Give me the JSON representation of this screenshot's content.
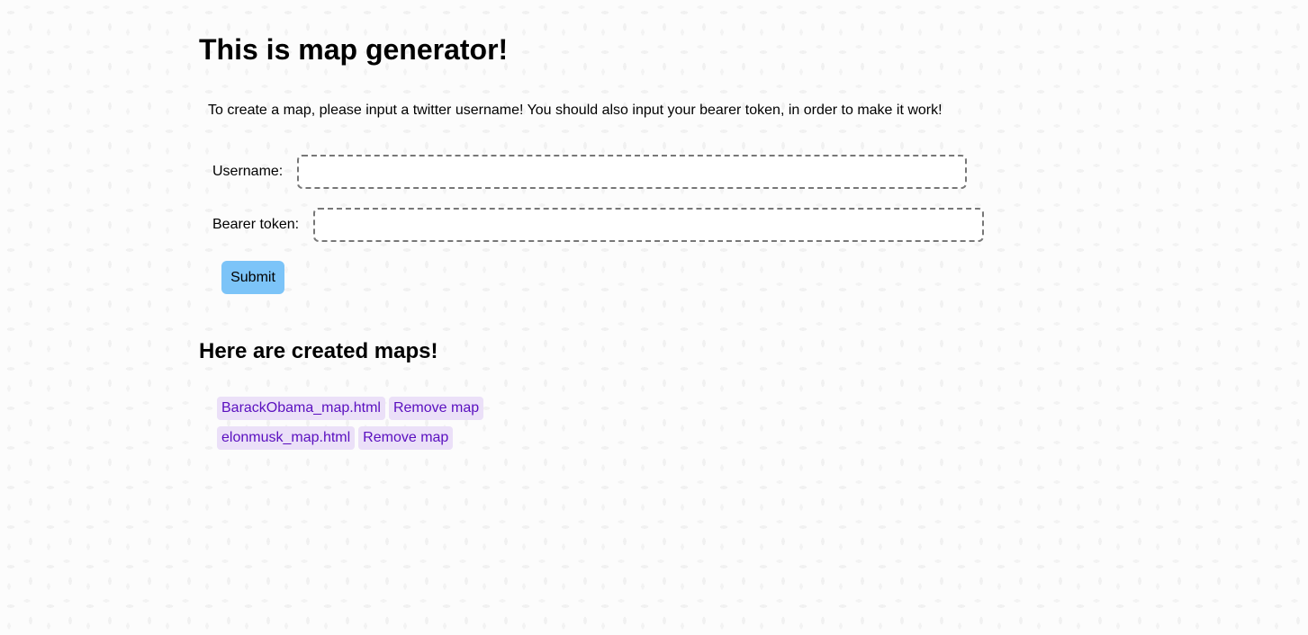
{
  "page": {
    "title": "This is map generator!",
    "intro": "To create a map, please input a twitter username! You should also input your bearer token, in order to make it work!"
  },
  "form": {
    "username_label": "Username:",
    "username_value": "",
    "token_label": "Bearer token:",
    "token_value": "",
    "submit_label": "Submit"
  },
  "maps": {
    "heading": "Here are created maps!",
    "items": [
      {
        "file": "BarackObama_map.html",
        "remove_label": "Remove map"
      },
      {
        "file": "elonmusk_map.html",
        "remove_label": "Remove map"
      }
    ]
  },
  "colors": {
    "submit_bg": "#7cc4f8",
    "link_bg": "#ebe0f8",
    "link_text": "#5a0fbf"
  }
}
